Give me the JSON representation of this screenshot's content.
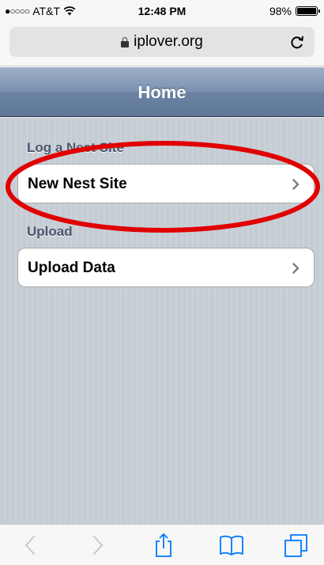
{
  "status_bar": {
    "carrier": "AT&T",
    "signal": "●○○○○",
    "time": "12:48 PM",
    "battery": "98%"
  },
  "browser": {
    "url": "iplover.org"
  },
  "header": {
    "title": "Home"
  },
  "sections": [
    {
      "label": "Log a Nest Site",
      "item": "New Nest Site"
    },
    {
      "label": "Upload",
      "item": "Upload Data"
    }
  ],
  "annotation": {
    "color": "#e00000"
  },
  "toolbar": {
    "icons": [
      "back-icon",
      "forward-icon",
      "share-icon",
      "bookmarks-icon",
      "tabs-icon"
    ],
    "tint": "#007aff",
    "disabled_tint": "#c7c7cc"
  }
}
